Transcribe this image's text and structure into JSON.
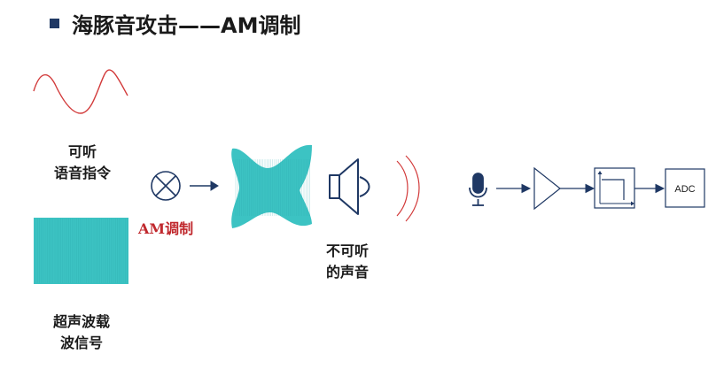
{
  "title": "海豚音攻击——AM调制",
  "labels": {
    "voice_line1": "可听",
    "voice_line2": "语音指令",
    "carrier_line1": "超声波载",
    "carrier_line2": "波信号",
    "modulation": "AM调制",
    "inaudible_line1": "不可听",
    "inaudible_line2": "的声音",
    "adc": "ADC"
  },
  "colors": {
    "voice_wave": "#d23a3a",
    "carrier": "#3cc3c3",
    "modulation_text": "#c0282d",
    "bullet": "#1f3864",
    "symbol_stroke": "#1f3864"
  }
}
